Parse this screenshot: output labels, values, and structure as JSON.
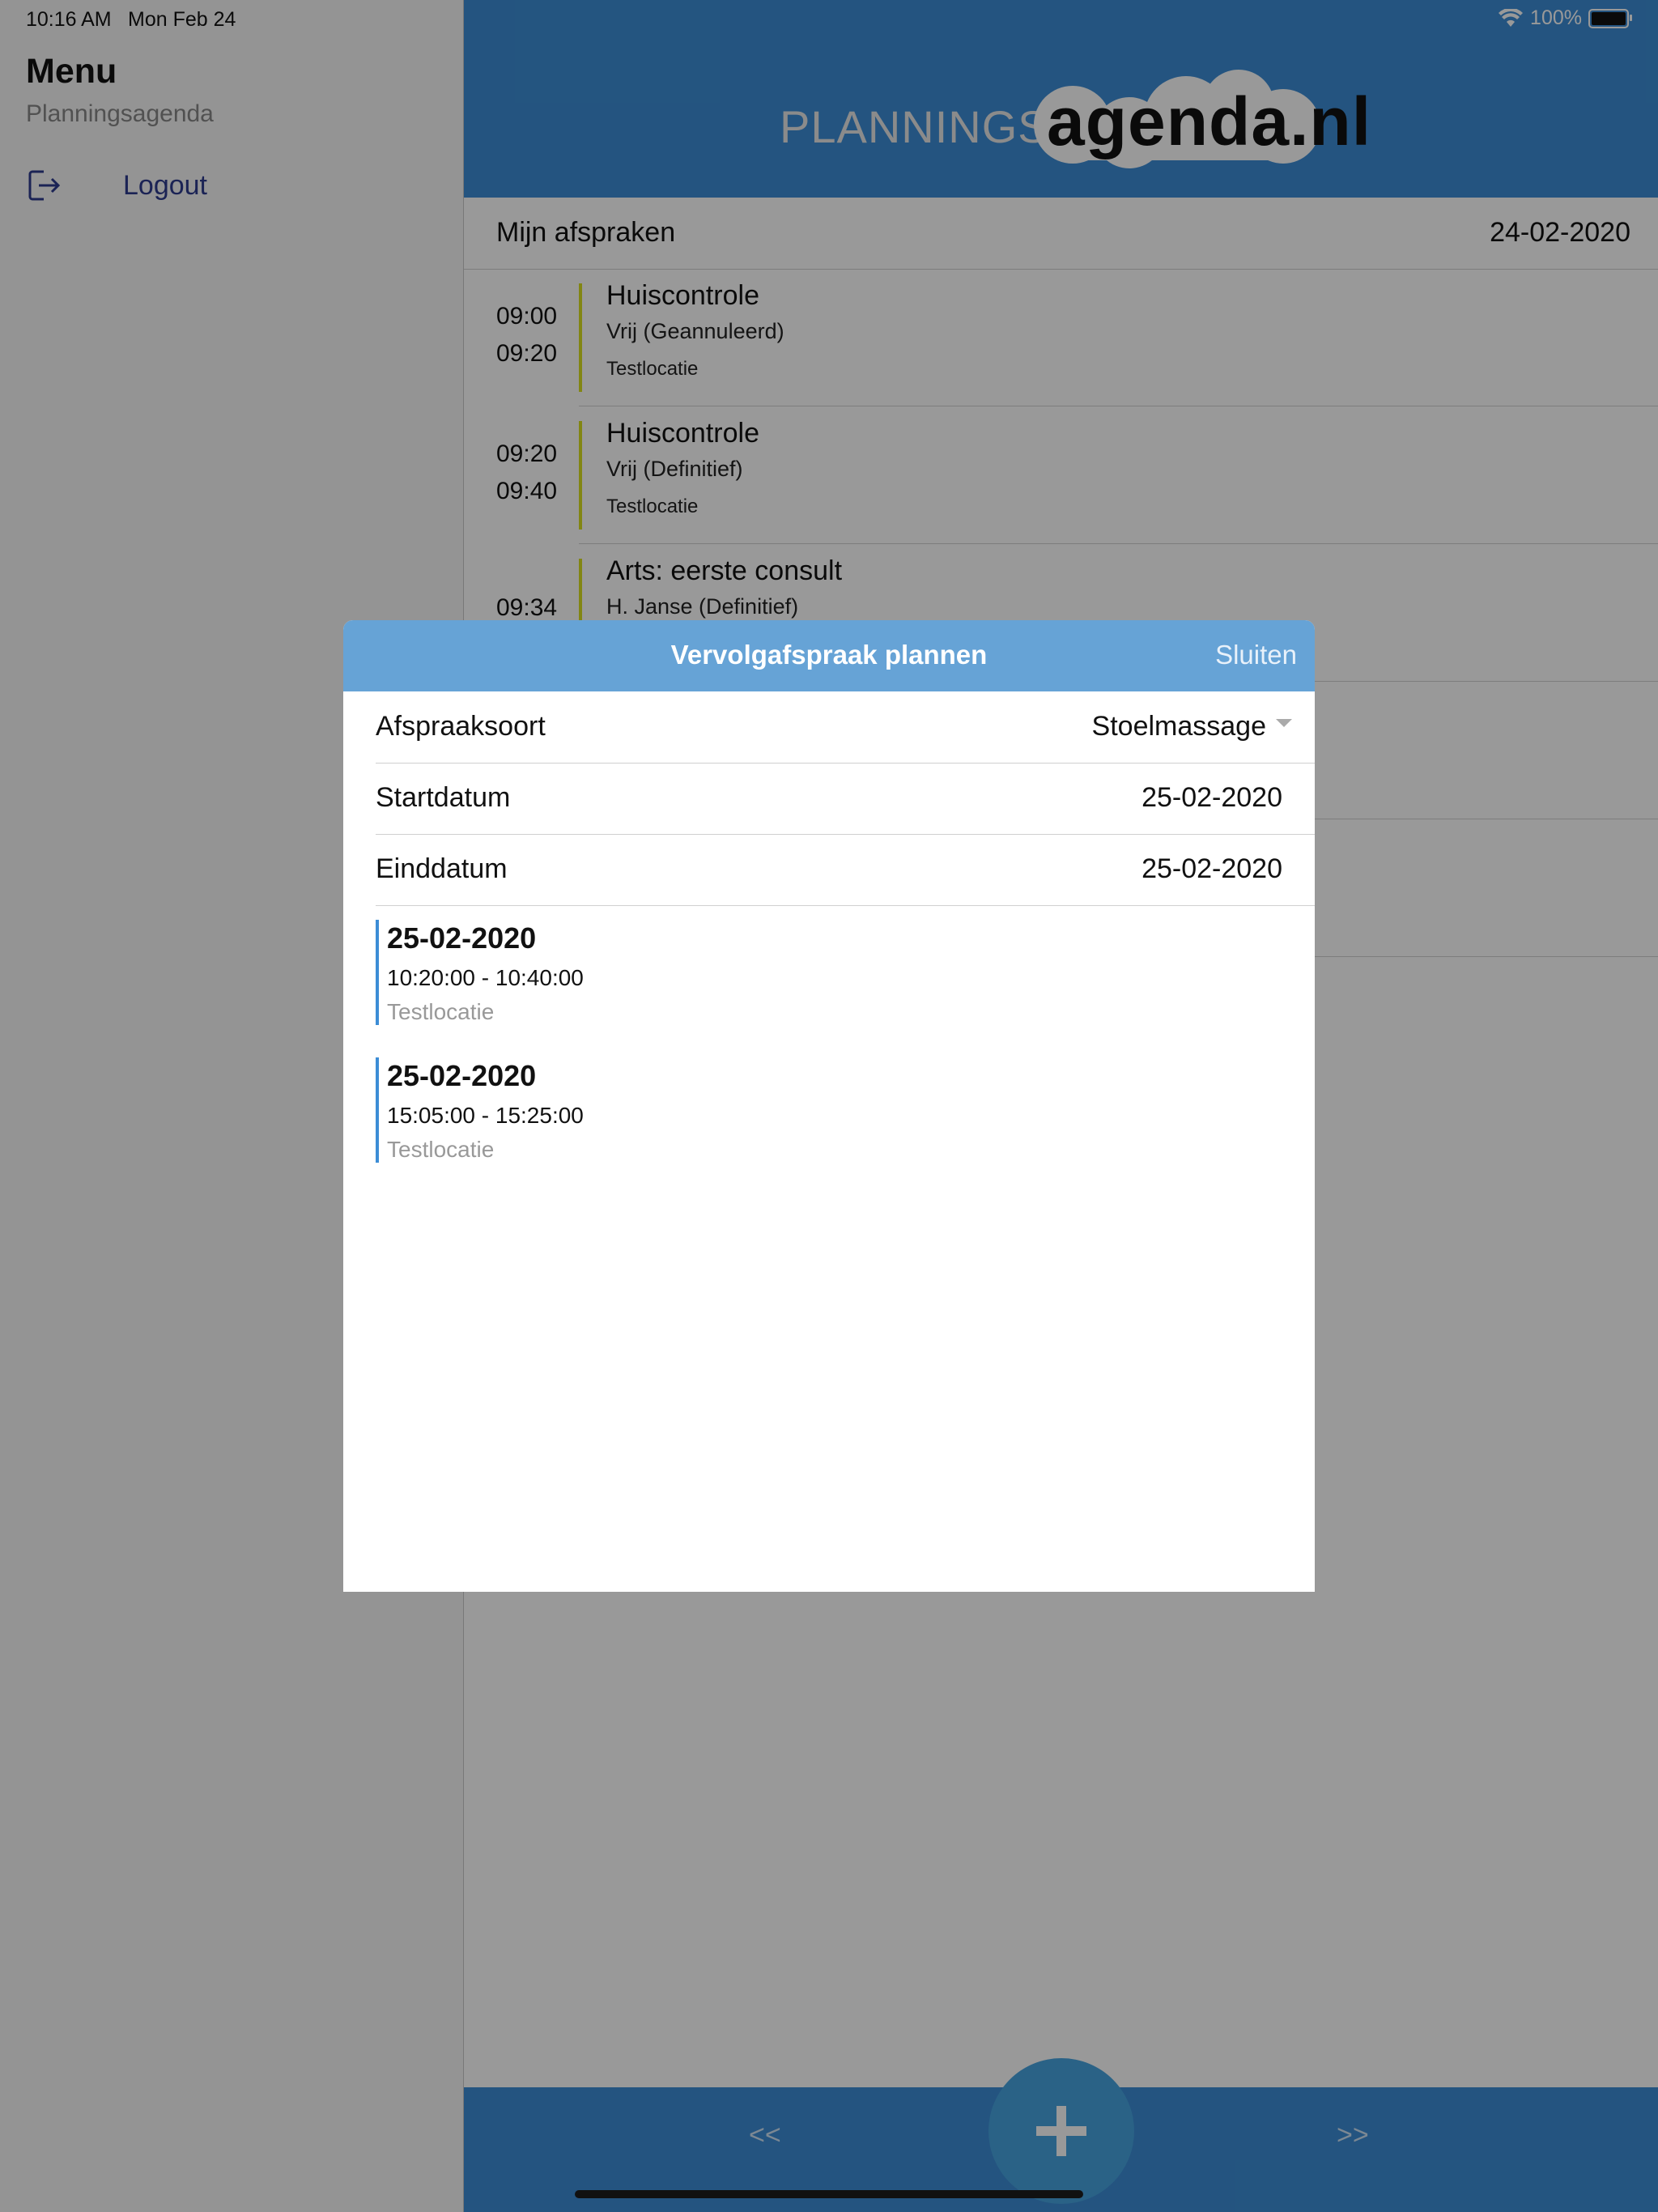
{
  "status": {
    "time": "10:16 AM",
    "date": "Mon Feb 24",
    "battery": "100%"
  },
  "sidebar": {
    "title": "Menu",
    "subtitle": "Planningsagenda",
    "logout_label": "Logout"
  },
  "header": {
    "logo_prefix": "PLANNINGS",
    "logo_main": "agenda.nl"
  },
  "list": {
    "title": "Mijn afspraken",
    "date": "24-02-2020",
    "appointments": [
      {
        "start": "09:00",
        "end": "09:20",
        "title": "Huiscontrole",
        "status": "Vrij (Geannuleerd)",
        "location": "Testlocatie"
      },
      {
        "start": "09:20",
        "end": "09:40",
        "title": "Huiscontrole",
        "status": "Vrij (Definitief)",
        "location": "Testlocatie"
      },
      {
        "start": "09:34",
        "end": "",
        "title": "Arts: eerste consult",
        "status": "H. Janse (Definitief)",
        "location": ""
      }
    ]
  },
  "nav": {
    "prev": "<<",
    "next": ">>"
  },
  "modal": {
    "title": "Vervolgafspraak plannen",
    "close": "Sluiten",
    "fields": {
      "type_label": "Afspraaksoort",
      "type_value": "Stoelmassage",
      "start_label": "Startdatum",
      "start_value": "25-02-2020",
      "end_label": "Einddatum",
      "end_value": "25-02-2020"
    },
    "slots": [
      {
        "date": "25-02-2020",
        "time": "10:20:00 - 10:40:00",
        "location": "Testlocatie"
      },
      {
        "date": "25-02-2020",
        "time": "15:05:00 - 15:25:00",
        "location": "Testlocatie"
      }
    ]
  },
  "colors": {
    "primary": "#3c8dd6",
    "modal_header": "#66a3d6",
    "accent_bar": "#d9e021",
    "fab": "#46a3e0"
  }
}
